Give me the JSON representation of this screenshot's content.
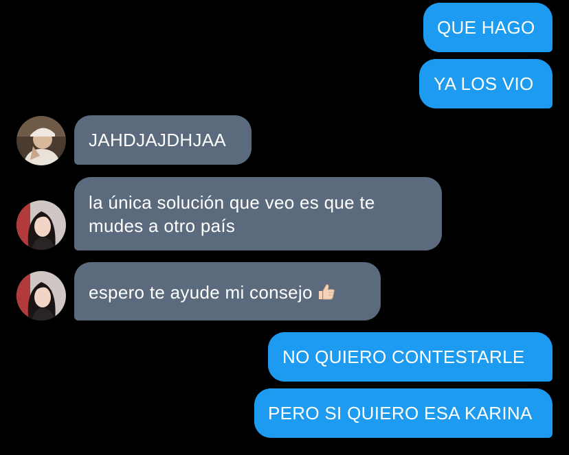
{
  "messages": [
    {
      "direction": "sent",
      "text": "QUE HAGO"
    },
    {
      "direction": "sent",
      "text": "YA LOS VIO"
    },
    {
      "direction": "received",
      "sender_avatar": "avatar-photo-cap",
      "text": "JAHDJAJDHJAA"
    },
    {
      "direction": "received",
      "sender_avatar": "avatar-photo-girl",
      "text_lines": [
        "la única solución que veo es que te",
        "mudes a otro país"
      ]
    },
    {
      "direction": "received",
      "sender_avatar": "avatar-photo-girl",
      "text": "espero te ayude mi consejo",
      "emoji": "thumbs-up-icon"
    },
    {
      "direction": "sent",
      "text": "NO QUIERO CONTESTARLE"
    },
    {
      "direction": "sent",
      "text": "PERO SI QUIERO ESA KARINA"
    }
  ],
  "colors": {
    "background": "#000000",
    "sent_bubble": "#1d9bf0",
    "received_bubble": "#5b6b7d",
    "text": "#ffffff"
  }
}
